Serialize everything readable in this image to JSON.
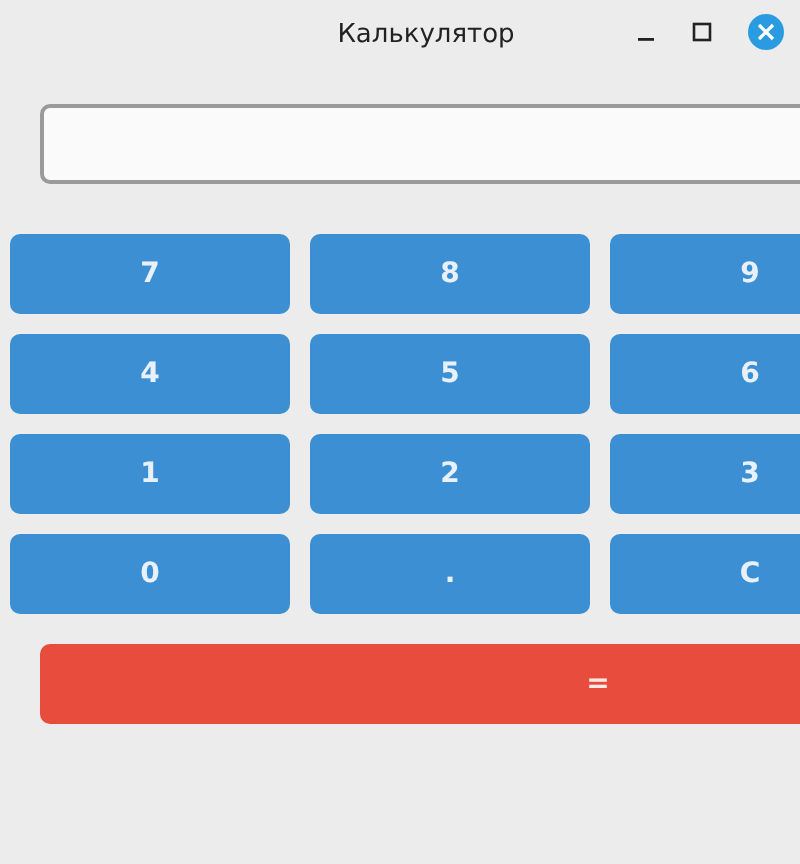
{
  "window": {
    "title": "Калькулятор"
  },
  "keys": [
    {
      "label": "7"
    },
    {
      "label": "8"
    },
    {
      "label": "9"
    },
    {
      "label": "4"
    },
    {
      "label": "5"
    },
    {
      "label": "6"
    },
    {
      "label": "1"
    },
    {
      "label": "2"
    },
    {
      "label": "3"
    },
    {
      "label": "0"
    },
    {
      "label": "."
    },
    {
      "label": "C"
    }
  ],
  "equals_button": {
    "label": "="
  }
}
